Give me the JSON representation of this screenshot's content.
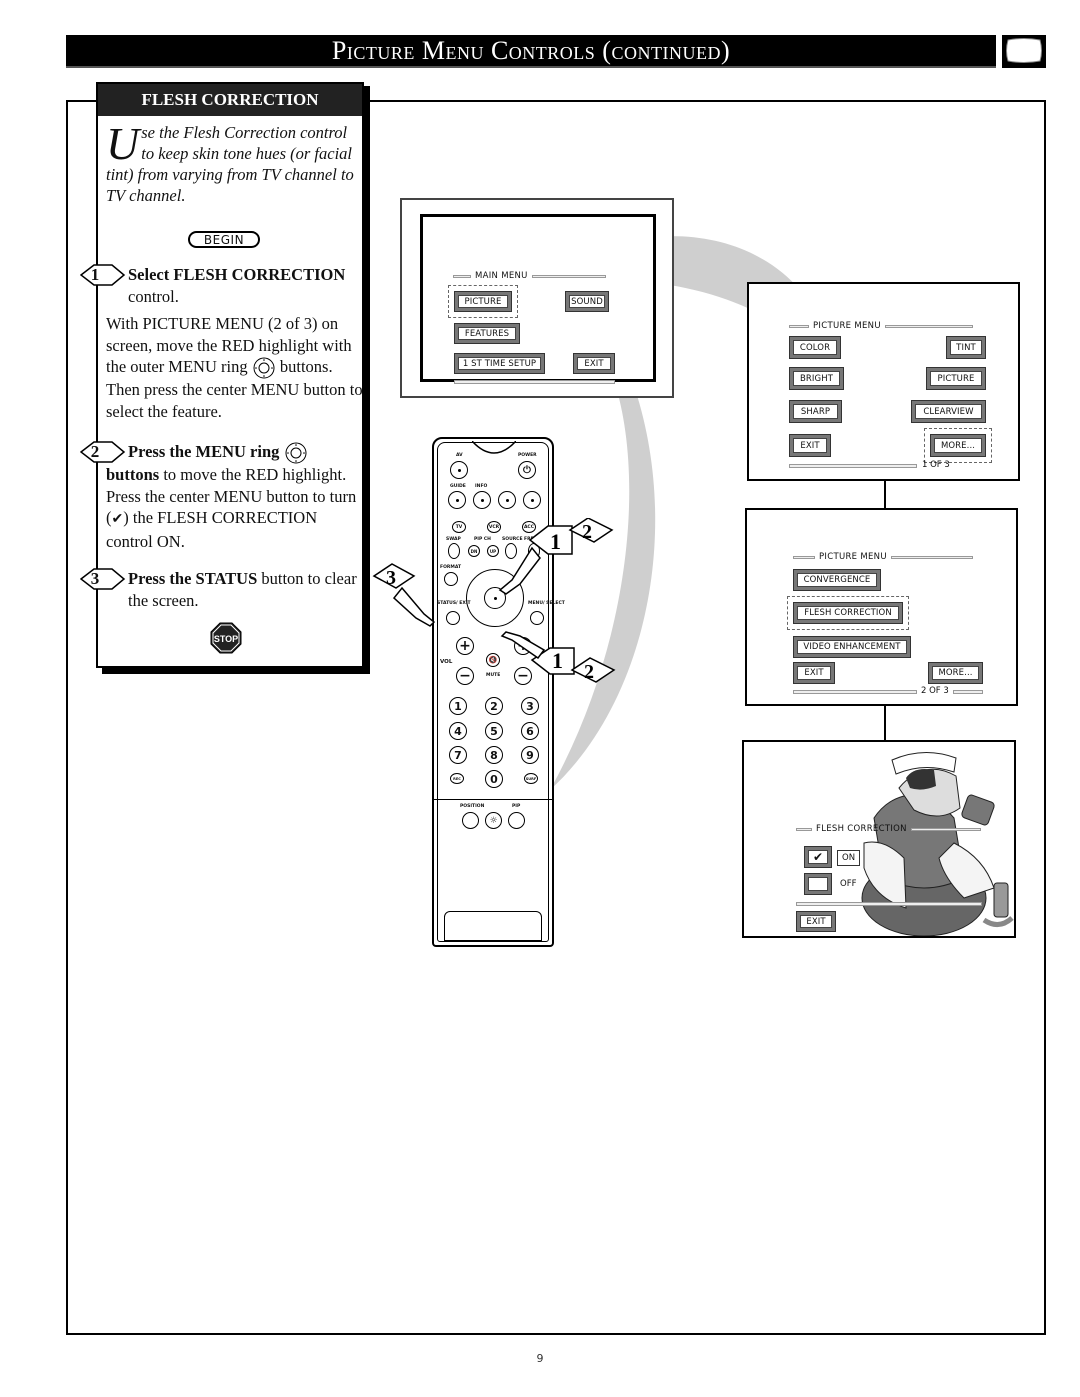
{
  "header": {
    "title": "Picture Menu Controls (continued)",
    "icon": "tv-screen-icon"
  },
  "left_panel": {
    "heading": "FLESH CORRECTION",
    "intro_dropcap": "U",
    "intro_rest": "se the  Flesh Correction control to keep skin tone hues (or facial tint) from varying from TV channel to TV channel.",
    "begin_label": "BEGIN",
    "steps": [
      {
        "number": "1",
        "bold_lead": "Select FLESH CORRECTION",
        "lead_rest": " control.",
        "body_before_icon": "With PICTURE MENU (2 of 3) on screen, move the RED highlight with the outer MENU ring",
        "body_after_icon": " buttons. Then press the center MENU button to select the feature."
      },
      {
        "number": "2",
        "bold_lead": "Press the MENU ring",
        "bold_lead_2": "buttons",
        "body": " to move the RED highlight. Press the center MENU button to turn (",
        "check_glyph": "✔",
        "body_after_check": ") the FLESH CORRECTION control ON."
      },
      {
        "number": "3",
        "bold_lead": "Press the STATUS",
        "body": " button to clear the screen."
      }
    ],
    "stop_label": "STOP"
  },
  "main_menu_screen": {
    "title": "MAIN MENU",
    "buttons": [
      "PICTURE",
      "SOUND",
      "FEATURES",
      "1 ST TIME SETUP",
      "EXIT"
    ],
    "highlighted": "PICTURE"
  },
  "picture_menu_1": {
    "title": "PICTURE MENU",
    "buttons": [
      "COLOR",
      "TINT",
      "BRIGHT",
      "PICTURE",
      "SHARP",
      "CLEARVIEW",
      "EXIT",
      "MORE..."
    ],
    "highlighted": "MORE...",
    "page": "1  OF 3"
  },
  "picture_menu_2": {
    "title": "PICTURE MENU",
    "buttons": [
      "CONVERGENCE",
      "FLESH CORRECTION",
      "VIDEO ENHANCEMENT",
      "EXIT",
      "MORE..."
    ],
    "highlighted": "FLESH CORRECTION",
    "page": "2  OF 3"
  },
  "flesh_correction_screen": {
    "title": "FLESH CORRECTION",
    "options": [
      {
        "label": "ON",
        "checked": true,
        "check_glyph": "✔"
      },
      {
        "label": "OFF",
        "checked": false,
        "check_glyph": ""
      }
    ],
    "exit_label": "EXIT"
  },
  "remote": {
    "labels": {
      "av": "AV",
      "power": "POWER",
      "guide": "GUIDE",
      "info": "INFO",
      "tv": "TV",
      "vcr": "VCR",
      "acc": "ACC",
      "swap": "SWAP",
      "pip_ch": "PIP CH",
      "source": "SOURCE",
      "freeze": "FREEZE",
      "dn": "DN",
      "up": "UP",
      "format": "FORMAT",
      "status_exit": "STATUS/ EXIT",
      "menu_select": "MENU/ SELECT",
      "vol": "VOL",
      "mute": "MUTE",
      "position": "POSITION",
      "pip": "PIP",
      "rec": "REC",
      "surf": "SURF"
    },
    "digits": [
      "1",
      "2",
      "3",
      "4",
      "5",
      "6",
      "7",
      "8",
      "9",
      "0"
    ],
    "callouts": [
      "1",
      "2",
      "3",
      "1",
      "2"
    ]
  },
  "footer": {
    "page_number": "9"
  }
}
